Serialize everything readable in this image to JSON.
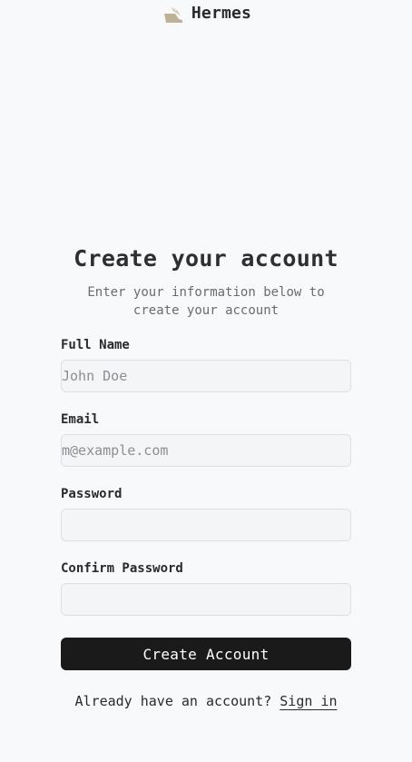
{
  "brand": {
    "name": "Hermes",
    "icon": "winged-shoe-icon",
    "icon_color": "#c4b59a"
  },
  "form": {
    "title": "Create your account",
    "subtitle": "Enter your information below to create your account",
    "fields": {
      "full_name": {
        "label": "Full Name",
        "placeholder": "John Doe",
        "value": ""
      },
      "email": {
        "label": "Email",
        "placeholder": "m@example.com",
        "value": ""
      },
      "password": {
        "label": "Password",
        "placeholder": "",
        "value": ""
      },
      "confirm_password": {
        "label": "Confirm Password",
        "placeholder": "",
        "value": ""
      }
    },
    "submit_label": "Create Account"
  },
  "footer": {
    "prompt": "Already have an account?",
    "link_label": "Sign in"
  },
  "colors": {
    "background": "#f8f9fb",
    "button": "#1a1a1a",
    "button_text": "#ffffff",
    "input_bg": "#f4f5f7",
    "input_border": "#dcdfe4"
  }
}
